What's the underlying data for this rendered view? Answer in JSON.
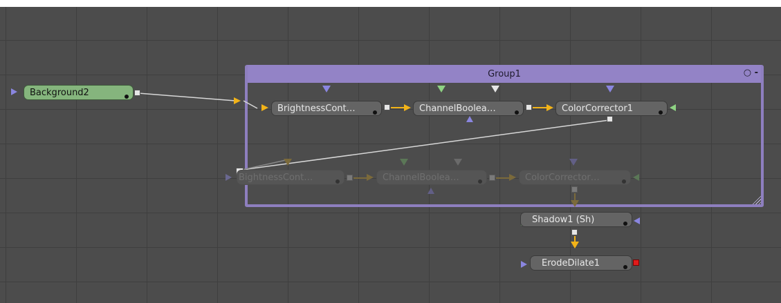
{
  "group": {
    "title": "Group1",
    "controls": "○ -"
  },
  "nodes": {
    "background2": "Background2",
    "brightness_top": "BrightnessCont…",
    "channel_top": "ChannelBoolea…",
    "colorcorrector_top": "ColorCorrector1",
    "brightness_bottom": "ightnessCont…",
    "brightness_bottom_prefix": "B",
    "channel_bottom": "ChannelBoolea…",
    "colorcorrector_bottom": "ColorCorrector…",
    "shadow1": "Shadow1  (Sh)",
    "erodedilate1": "ErodeDilate1"
  },
  "colors": {
    "canvas": "#4c4c4c",
    "grid": "#3f3f3f",
    "group_accent": "#9383c6",
    "node_tile": "#646464",
    "background_node": "#85b57d",
    "link_yellow": "#f2b318",
    "input_blue": "#8a86e0",
    "input_green": "#8ed283",
    "output_white": "#e6e6e6",
    "output_red": "#e01b1b"
  }
}
